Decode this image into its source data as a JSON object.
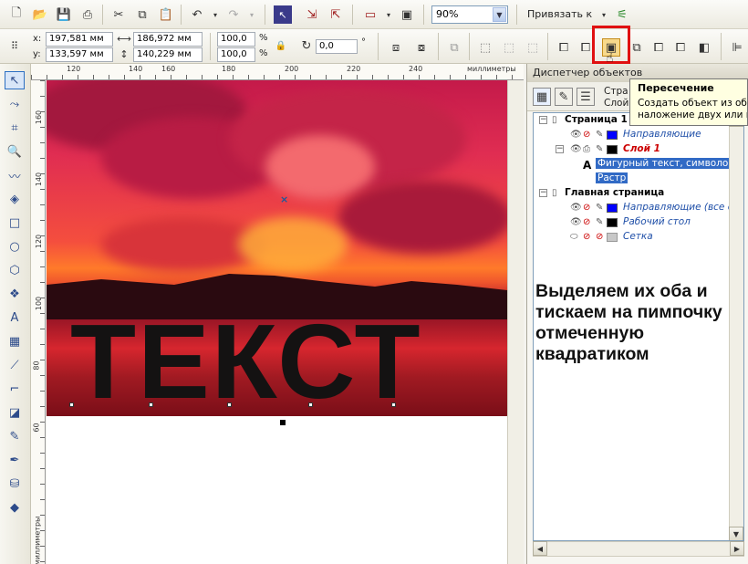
{
  "toolbar_top": {
    "zoom_value": "90%",
    "snap_label": "Привязать к"
  },
  "property_bar": {
    "x_label": "x:",
    "x_value": "197,581 мм",
    "y_label": "y:",
    "y_value": "133,597 мм",
    "width_value": "186,972 мм",
    "height_value": "140,229 мм",
    "scale_x": "100,0",
    "scale_y": "100,0",
    "percent": "%",
    "rotation_value": "0,0",
    "degree": "°"
  },
  "ruler": {
    "h_ticks": [
      "120",
      "140",
      "160",
      "180",
      "200",
      "220",
      "240"
    ],
    "h_units": "миллиметры",
    "v_ticks": [
      "160",
      "140",
      "120",
      "100",
      "80",
      "60"
    ],
    "v_units": "миллиметры"
  },
  "canvas": {
    "big_text": "ТЕКСТ"
  },
  "docker": {
    "title": "Диспетчер объектов",
    "header_line1": "Стра",
    "header_line2": "Слой",
    "tree": [
      {
        "label": "Страница 1",
        "kind": "page"
      },
      {
        "label": "Направляющие",
        "color": "#0000ff",
        "kind": "layer"
      },
      {
        "label": "Слой 1",
        "color": "#000000",
        "kind": "layer-active"
      },
      {
        "label": "Фигурный текст, символов: А",
        "kind": "object"
      },
      {
        "label": "Растр",
        "kind": "object"
      },
      {
        "label": "Главная страница",
        "kind": "page"
      },
      {
        "label": "Направляющие (все стр",
        "color": "#0000ff",
        "kind": "master-layer"
      },
      {
        "label": "Рабочий стол",
        "color": "#000000",
        "kind": "master-layer"
      },
      {
        "label": "Сетка",
        "color": "#c8c8c8",
        "kind": "master-layer"
      }
    ]
  },
  "annotation": {
    "line1": "Выделяем их оба и",
    "line2": "тискаем на пимпочку",
    "line3": "отмеченную",
    "line4": "квадратиком"
  },
  "tooltip": {
    "title": "Пересечение",
    "line1": "Создать объект из обла",
    "line2": "наложение двух или не"
  },
  "colors": {
    "highlight": "#316ac5",
    "red_frame": "#e01010",
    "layer_red": "#cc0000",
    "link_blue": "#1f4fa8"
  }
}
